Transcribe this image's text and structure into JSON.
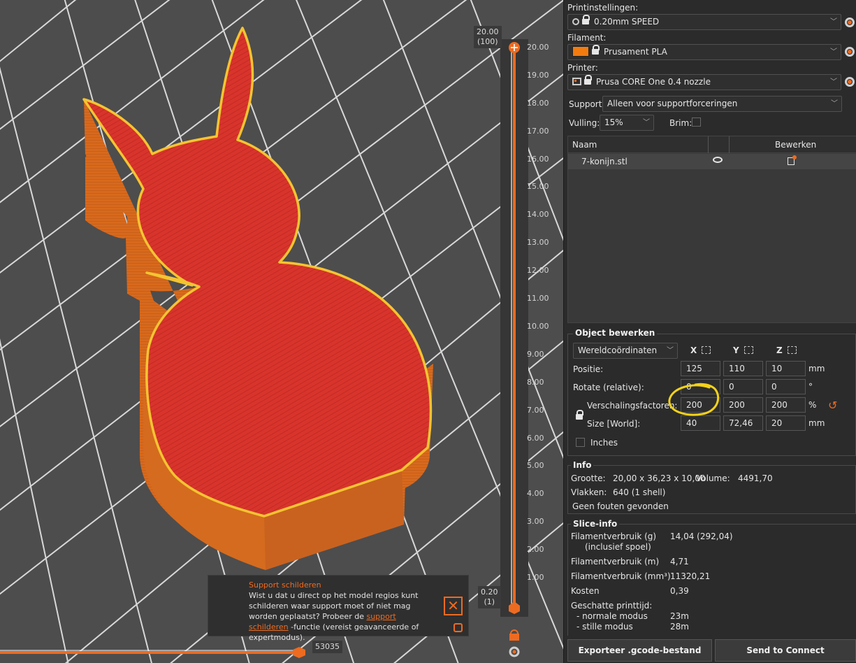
{
  "sidebar": {
    "print_settings": {
      "label": "Printinstellingen:",
      "value": "0.20mm SPEED"
    },
    "filament": {
      "label": "Filament:",
      "value": "Prusament PLA",
      "color": "#f27b0f"
    },
    "printer": {
      "label": "Printer:",
      "value": "Prusa CORE One 0.4 nozzle"
    },
    "support": {
      "label": "Support:",
      "value": "Alleen voor supportforceringen"
    },
    "infill": {
      "label": "Vulling:",
      "value": "15%"
    },
    "brim": {
      "label": "Brim:",
      "checked": false
    },
    "object_list": {
      "col_name": "Naam",
      "col_edit": "Bewerken",
      "rows": [
        {
          "name": "7-konijn.stl"
        }
      ]
    }
  },
  "object_edit": {
    "title": "Object bewerken",
    "coord_mode": "Wereldcoördinaten",
    "axes": [
      "X",
      "Y",
      "Z"
    ],
    "position": {
      "label": "Positie:",
      "x": "125",
      "y": "110",
      "z": "10",
      "unit": "mm"
    },
    "rotate": {
      "label": "Rotate (relative):",
      "x": "0",
      "y": "0",
      "z": "0",
      "unit": "°"
    },
    "scale": {
      "label": "Verschalingsfactoren:",
      "x": "200",
      "y": "200",
      "z": "200",
      "unit": "%"
    },
    "size": {
      "label": "Size [World]:",
      "x": "40",
      "y": "72,46",
      "z": "20",
      "unit": "mm"
    },
    "inches_label": "Inches"
  },
  "info": {
    "title": "Info",
    "size_label": "Grootte:",
    "size_value": "20,00 x 36,23 x 10,00",
    "volume_label": "Volume:",
    "volume_value": "4491,70",
    "facets_label": "Vlakken:",
    "facets_value": "640 (1 shell)",
    "errors": "Geen fouten gevonden"
  },
  "slice_info": {
    "title": "Slice-info",
    "filament_g_label": "Filamentverbruik (g)",
    "filament_g_sub": "(inclusief spoel)",
    "filament_g_value": "14,04 (292,04)",
    "filament_m_label": "Filamentverbruik (m)",
    "filament_m_value": "4,71",
    "filament_mm3_label": "Filamentverbruik (mm³)",
    "filament_mm3_value": "11320,21",
    "cost_label": "Kosten",
    "cost_value": "0,39",
    "time_label": "Geschatte printtijd:",
    "normal_label": "- normale modus",
    "normal_value": "23m",
    "silent_label": "- stille modus",
    "silent_value": "28m"
  },
  "buttons": {
    "export": "Exporteer .gcode-bestand",
    "connect": "Send to Connect"
  },
  "viewport": {
    "layer_top_value": "20.00",
    "layer_top_index": "(100)",
    "layer_bottom_value": "0.20",
    "layer_bottom_index": "(1)",
    "ticks": [
      "20.00",
      "19.00",
      "18.00",
      "17.00",
      "16.00",
      "15.00",
      "14.00",
      "13.00",
      "12.00",
      "11.00",
      "10.00",
      "9.00",
      "8.00",
      "7.00",
      "6.00",
      "5.00",
      "4.00",
      "3.00",
      "2.00",
      "1.00"
    ],
    "horizontal_slider_value": "53035"
  },
  "tip": {
    "title": "Support schilderen",
    "body_pre": "Wist u dat u direct op het model regios kunt schilderen waar support moet of niet mag worden geplaatst? Probeer de ",
    "link": "support schilderen",
    "body_post": " -functie (vereist geavanceerde of expertmodus)."
  }
}
